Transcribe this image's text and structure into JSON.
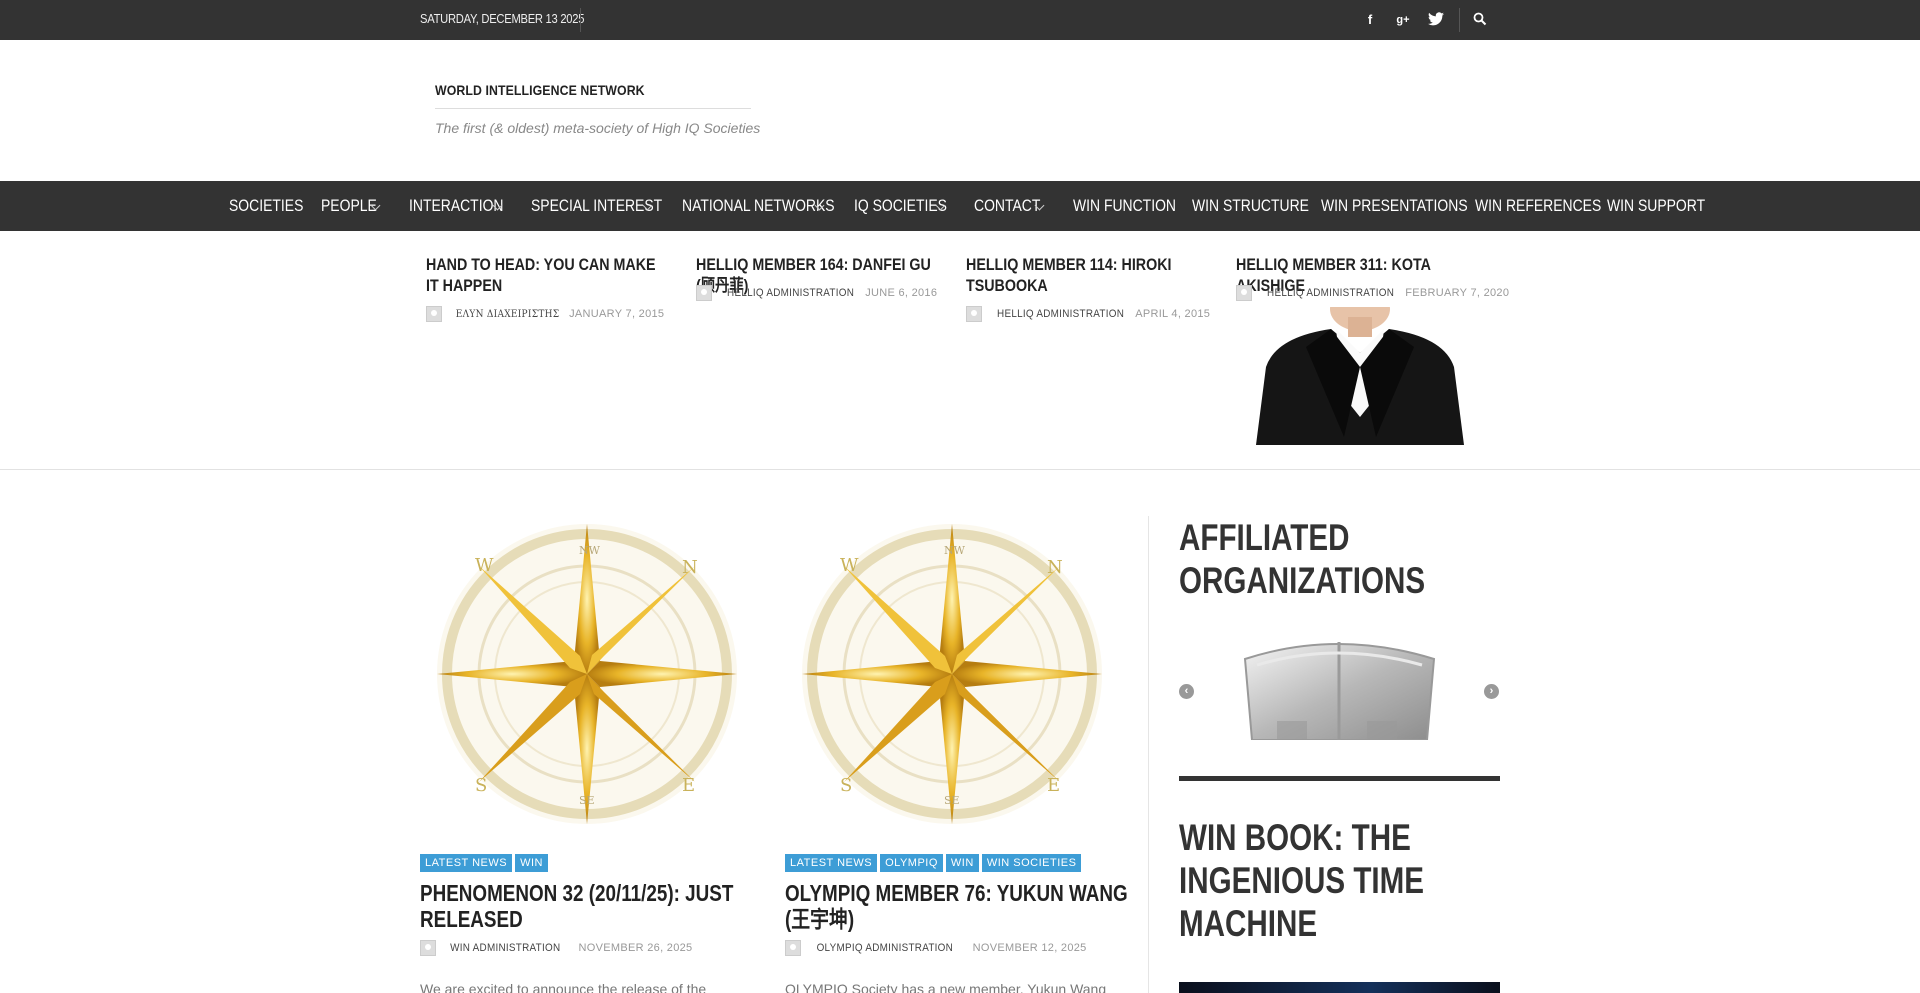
{
  "topbar": {
    "date": "SATURDAY, DECEMBER 13 2025",
    "social": [
      "facebook-icon",
      "google-plus-icon",
      "twitter-icon"
    ],
    "search_icon": "search-icon"
  },
  "header": {
    "site_title": "WORLD INTELLIGENCE NETWORK",
    "tagline": "The first (& oldest) meta-society of High IQ Societies"
  },
  "nav": {
    "items": [
      {
        "label": "SOCIETIES"
      },
      {
        "label": "PEOPLE"
      },
      {
        "label": "INTERACTION"
      },
      {
        "label": "SPECIAL INTEREST"
      },
      {
        "label": "NATIONAL NETWORKS"
      },
      {
        "label": "IQ SOCIETIES"
      },
      {
        "label": "CONTACT"
      },
      {
        "label": "WIN FUNCTION"
      },
      {
        "label": "WIN STRUCTURE"
      },
      {
        "label": "WIN PRESENTATIONS"
      },
      {
        "label": "WIN REFERENCES"
      },
      {
        "label": "WIN SUPPORT"
      }
    ]
  },
  "featured": [
    {
      "title": "HAND TO HEAD: YOU CAN MAKE IT HAPPEN",
      "author": "ΕΛΥΝ ΔΙΑΧΕΙΡΙΣΤΗΣ",
      "date": "JANUARY 7, 2015"
    },
    {
      "title": "HELLIQ MEMBER 164: DANFEI GU (顾丹菲)",
      "author": "HELLIQ ADMINISTRATION",
      "date": "JUNE 6, 2016"
    },
    {
      "title": "HELLIQ MEMBER 114: HIROKI TSUBOOKA",
      "author": "HELLIQ ADMINISTRATION",
      "date": "APRIL 4, 2015"
    },
    {
      "title": "HELLIQ MEMBER 311: KOTA AKISHIGE",
      "author": "HELLIQ ADMINISTRATION",
      "date": "FEBRUARY 7, 2020"
    }
  ],
  "posts": [
    {
      "categories": [
        "LATEST NEWS",
        "WIN"
      ],
      "title": "PHENOMENON 32 (20/11/25): JUST RELEASED",
      "author": "WIN ADMINISTRATION",
      "date": "NOVEMBER 26, 2025",
      "excerpt": "We are excited to announce the release of the"
    },
    {
      "categories": [
        "LATEST NEWS",
        "OLYMPIQ",
        "WIN",
        "WIN SOCIETIES"
      ],
      "title": "OLYMPIQ MEMBER 76: YUKUN WANG (王宇坤)",
      "author": "OLYMPIQ ADMINISTRATION",
      "date": "NOVEMBER 12, 2025",
      "excerpt": "OLYMPIQ Society has a new member, Yukun Wang"
    }
  ],
  "sidebar": {
    "affiliated_title": "AFFILIATED ORGANIZATIONS",
    "prev_icon": "chevron-left-icon",
    "next_icon": "chevron-right-icon",
    "book_title": "WIN BOOK: THE INGENIOUS TIME MACHINE"
  },
  "colors": {
    "dark_bar": "#333333",
    "category_badge": "#3d9dd6",
    "compass_gold": "#e8b428"
  }
}
